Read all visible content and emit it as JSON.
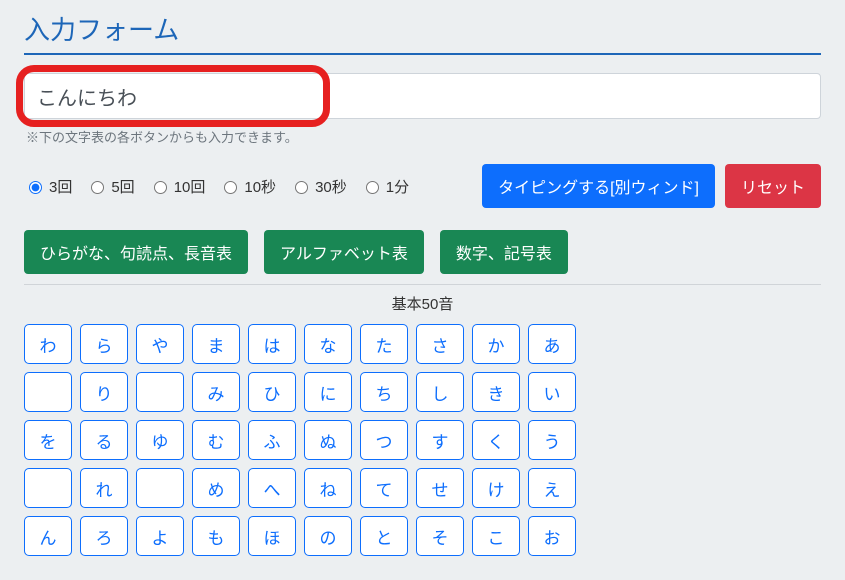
{
  "title": "入力フォーム",
  "input": {
    "value": "こんにちわ"
  },
  "helper_text": "※下の文字表の各ボタンからも入力できます。",
  "radio_options": [
    "3回",
    "5回",
    "10回",
    "10秒",
    "30秒",
    "1分"
  ],
  "radio_selected_index": 0,
  "action_buttons": {
    "typing": "タイピングする[別ウィンド]",
    "reset": "リセット"
  },
  "tabs": [
    "ひらがな、句読点、長音表",
    "アルファベット表",
    "数字、記号表"
  ],
  "kana_section_title": "基本50音",
  "kana_grid": [
    [
      "わ",
      "ら",
      "や",
      "ま",
      "は",
      "な",
      "た",
      "さ",
      "か",
      "あ"
    ],
    [
      "",
      "り",
      "",
      "み",
      "ひ",
      "に",
      "ち",
      "し",
      "き",
      "い"
    ],
    [
      "を",
      "る",
      "ゆ",
      "む",
      "ふ",
      "ぬ",
      "つ",
      "す",
      "く",
      "う"
    ],
    [
      "",
      "れ",
      "",
      "め",
      "へ",
      "ね",
      "て",
      "せ",
      "け",
      "え"
    ],
    [
      "ん",
      "ろ",
      "よ",
      "も",
      "ほ",
      "の",
      "と",
      "そ",
      "こ",
      "お"
    ]
  ]
}
